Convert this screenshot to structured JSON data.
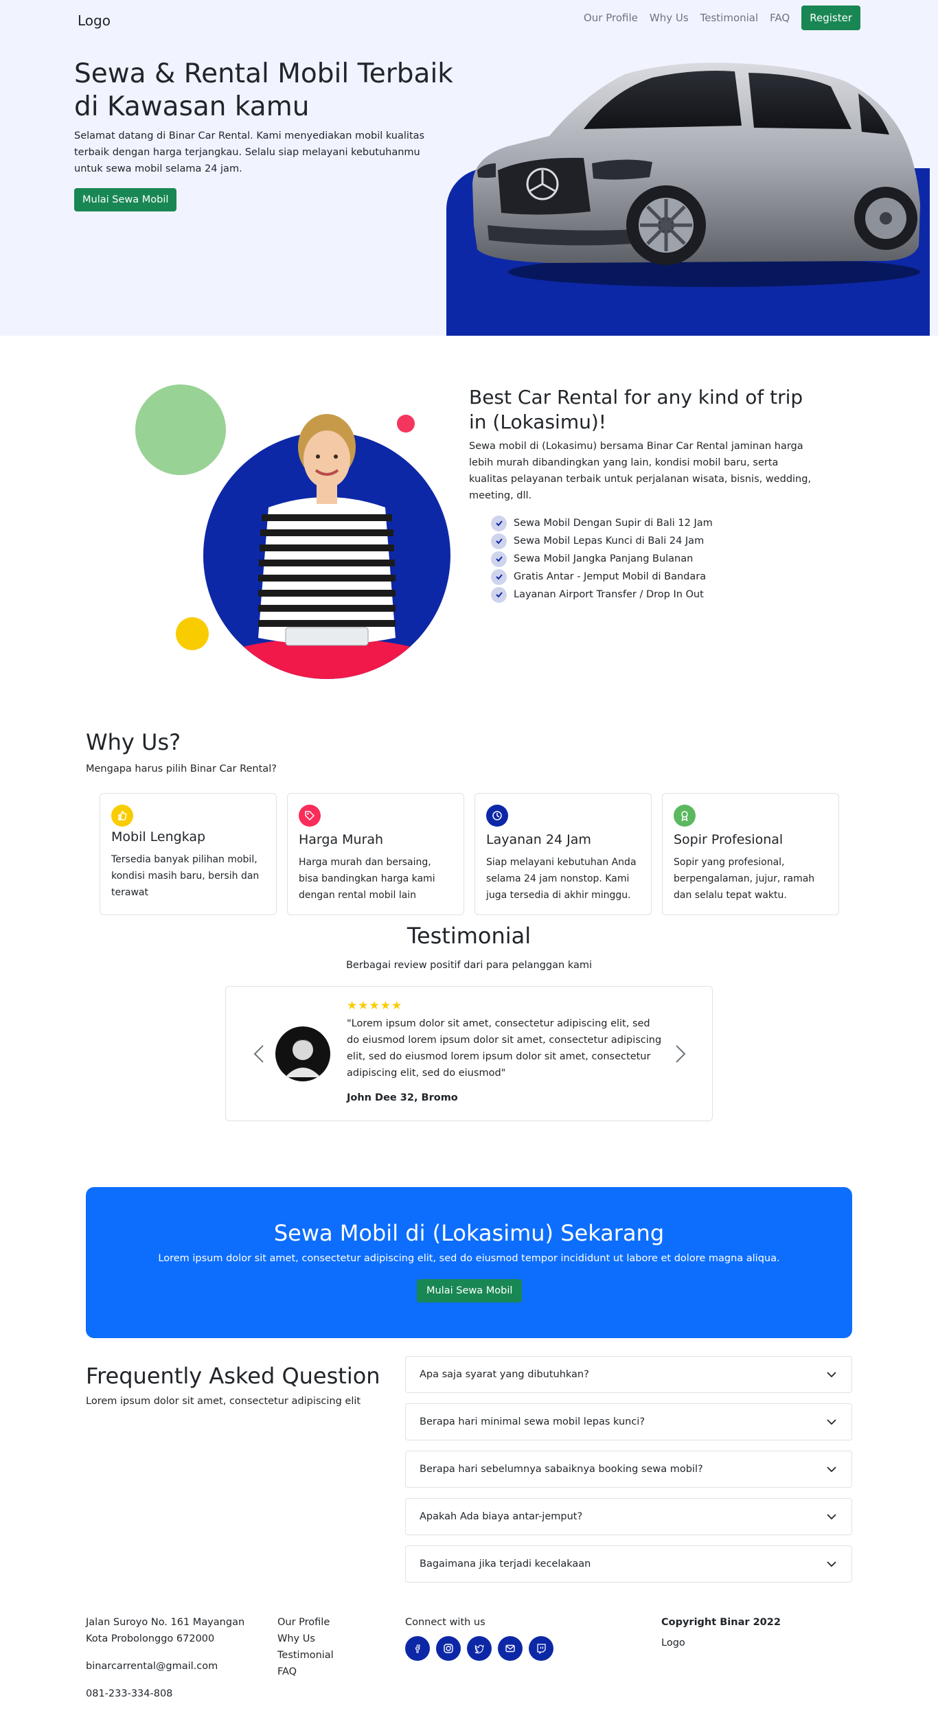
{
  "nav": {
    "logo": "Logo",
    "links": [
      "Our Profile",
      "Why Us",
      "Testimonial",
      "FAQ"
    ],
    "register_label": "Register"
  },
  "hero": {
    "title": "Sewa & Rental Mobil Terbaik di Kawasan kamu",
    "description": "Selamat datang di Binar Car Rental. Kami menyediakan mobil kualitas terbaik dengan harga terjangkau. Selalu siap melayani kebutuhanmu untuk sewa mobil selama 24 jam.",
    "cta_label": "Mulai Sewa Mobil"
  },
  "about": {
    "title": "Best Car Rental for any kind of trip in (Lokasimu)!",
    "description": "Sewa mobil di (Lokasimu) bersama Binar Car Rental jaminan harga lebih murah dibandingkan yang lain, kondisi mobil baru, serta kualitas pelayanan terbaik untuk perjalanan wisata, bisnis, wedding, meeting, dll.",
    "features": [
      "Sewa Mobil Dengan Supir di Bali 12 Jam",
      "Sewa Mobil Lepas Kunci di Bali 24 Jam",
      "Sewa Mobil Jangka Panjang Bulanan",
      "Gratis Antar - Jemput Mobil di Bandara",
      "Layanan Airport Transfer / Drop In Out"
    ]
  },
  "why": {
    "title": "Why Us?",
    "subtitle": "Mengapa harus pilih Binar Car Rental?",
    "cards": [
      {
        "icon": "thumbs-up-icon",
        "color": "#f9cc00",
        "title": "Mobil Lengkap",
        "text": "Tersedia banyak pilihan mobil, kondisi masih baru, bersih dan terawat"
      },
      {
        "icon": "tag-icon",
        "color": "#fa2c5a",
        "title": "Harga Murah",
        "text": "Harga murah dan bersaing, bisa bandingkan harga kami dengan rental mobil lain"
      },
      {
        "icon": "clock-icon",
        "color": "#0d28a6",
        "title": "Layanan 24 Jam",
        "text": "Siap melayani kebutuhan Anda selama 24 jam nonstop. Kami juga tersedia di akhir minggu."
      },
      {
        "icon": "award-icon",
        "color": "#5cb85f",
        "title": "Sopir Profesional",
        "text": "Sopir yang profesional, berpengalaman, jujur, ramah dan selalu tepat waktu."
      }
    ]
  },
  "testimonial": {
    "title": "Testimonial",
    "subtitle": "Berbagai review positif dari para pelanggan kami",
    "stars": "★★★★★",
    "rating": 5,
    "quote": "\"Lorem ipsum dolor sit amet, consectetur adipiscing elit, sed do eiusmod lorem ipsum dolor sit amet, consectetur adipiscing elit, sed do eiusmod lorem ipsum dolor sit amet, consectetur adipiscing elit, sed do eiusmod\"",
    "author": "John Dee 32, Bromo"
  },
  "cta": {
    "title": "Sewa Mobil di (Lokasimu) Sekarang",
    "text": "Lorem ipsum dolor sit amet, consectetur adipiscing elit, sed do eiusmod tempor incididunt ut labore et dolore magna aliqua.",
    "button_label": "Mulai Sewa Mobil"
  },
  "faq": {
    "title": "Frequently Asked Question",
    "subtitle": "Lorem ipsum dolor sit amet, consectetur adipiscing elit",
    "items": [
      "Apa saja syarat yang dibutuhkan?",
      "Berapa hari minimal sewa mobil lepas kunci?",
      "Berapa hari sebelumnya sabaiknya booking sewa mobil?",
      "Apakah Ada biaya antar-jemput?",
      "Bagaimana jika terjadi kecelakaan"
    ]
  },
  "footer": {
    "address_line1": "Jalan Suroyo No. 161 Mayangan",
    "address_line2": "Kota Probolonggo 672000",
    "email": "binarcarrental@gmail.com",
    "phone": "081-233-334-808",
    "links": [
      "Our Profile",
      "Why Us",
      "Testimonial",
      "FAQ"
    ],
    "connect_title": "Connect with us",
    "social_icons": [
      "facebook-icon",
      "instagram-icon",
      "twitter-icon",
      "mail-icon",
      "twitch-icon"
    ],
    "copyright": "Copyright Binar 2022",
    "logo": "Logo"
  },
  "colors": {
    "hero_bg": "#f1f3ff",
    "brand_blue": "#0d28a6",
    "primary_green": "#198754",
    "cta_blue": "#0d6efd"
  }
}
